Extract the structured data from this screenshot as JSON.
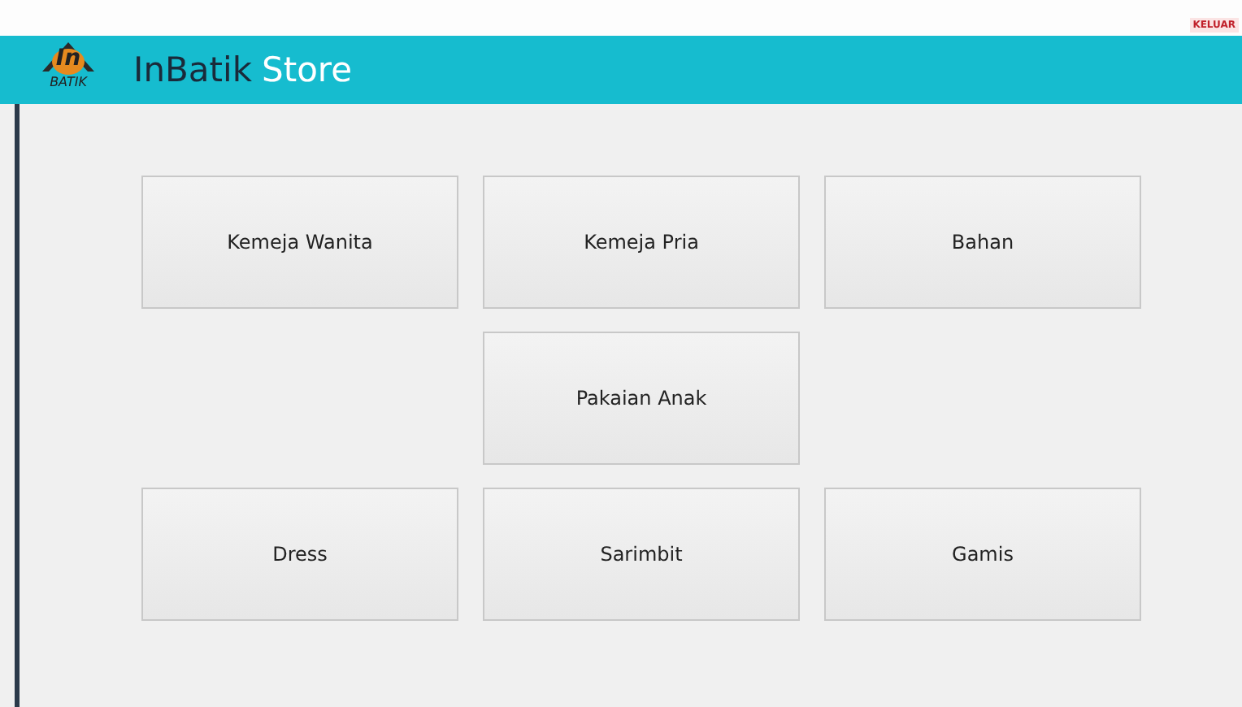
{
  "window": {
    "exit_label": "KELUAR"
  },
  "header": {
    "logo_mark": "In",
    "logo_caption": "BATIK",
    "title_main": "InBatik",
    "title_suffix": "Store"
  },
  "menu_rows": [
    {
      "items": [
        {
          "kind": "button",
          "label": "Kemeja Wanita"
        },
        {
          "kind": "button",
          "label": "Kemeja Pria"
        },
        {
          "kind": "button",
          "label": "Bahan"
        }
      ]
    },
    {
      "items": [
        {
          "kind": "blank"
        },
        {
          "kind": "button",
          "label": "Pakaian Anak"
        },
        {
          "kind": "blank"
        }
      ]
    },
    {
      "items": [
        {
          "kind": "button",
          "label": "Dress"
        },
        {
          "kind": "button",
          "label": "Sarimbit"
        },
        {
          "kind": "button",
          "label": "Gamis"
        }
      ]
    }
  ]
}
